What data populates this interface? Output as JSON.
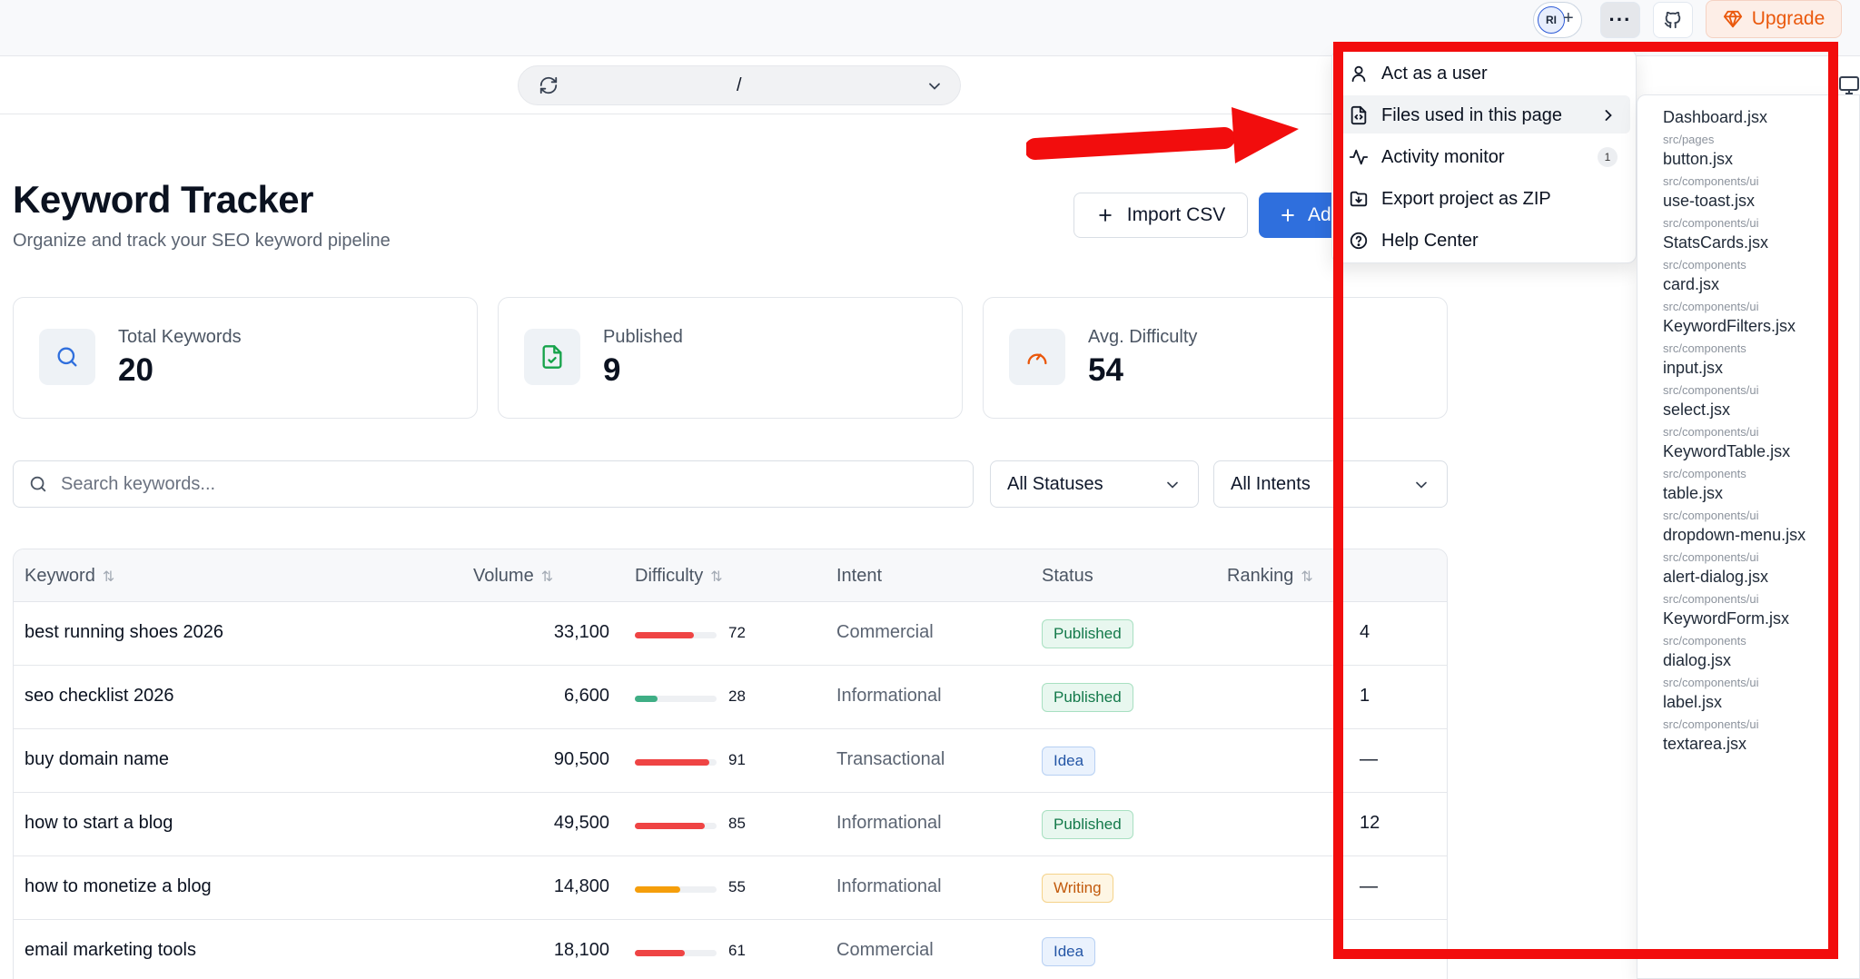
{
  "topbar": {
    "avatar_initials": "RI",
    "avatar_add": "+",
    "more_label": "···",
    "upgrade_label": "Upgrade"
  },
  "urlbar": {
    "path": "/"
  },
  "header": {
    "title": "Keyword Tracker",
    "subtitle": "Organize and track your SEO keyword pipeline",
    "import_label": "Import CSV",
    "add_label": "Ad"
  },
  "stats": [
    {
      "label": "Total Keywords",
      "value": "20",
      "icon": "search-icon"
    },
    {
      "label": "Published",
      "value": "9",
      "icon": "file-check-icon"
    },
    {
      "label": "Avg. Difficulty",
      "value": "54",
      "icon": "gauge-icon"
    }
  ],
  "filters": {
    "search_placeholder": "Search keywords...",
    "status_value": "All Statuses",
    "intent_value": "All Intents"
  },
  "table": {
    "columns": [
      "Keyword",
      "Volume",
      "Difficulty",
      "Intent",
      "Status",
      "Ranking"
    ],
    "rows": [
      {
        "keyword": "best running shoes 2026",
        "volume": "33,100",
        "difficulty": 72,
        "intent": "Commercial",
        "status": "Published",
        "ranking": "4"
      },
      {
        "keyword": "seo checklist 2026",
        "volume": "6,600",
        "difficulty": 28,
        "intent": "Informational",
        "status": "Published",
        "ranking": "1"
      },
      {
        "keyword": "buy domain name",
        "volume": "90,500",
        "difficulty": 91,
        "intent": "Transactional",
        "status": "Idea",
        "ranking": "—"
      },
      {
        "keyword": "how to start a blog",
        "volume": "49,500",
        "difficulty": 85,
        "intent": "Informational",
        "status": "Published",
        "ranking": "12"
      },
      {
        "keyword": "how to monetize a blog",
        "volume": "14,800",
        "difficulty": 55,
        "intent": "Informational",
        "status": "Writing",
        "ranking": "—"
      },
      {
        "keyword": "email marketing tools",
        "volume": "18,100",
        "difficulty": 61,
        "intent": "Commercial",
        "status": "Idea",
        "ranking": "—"
      }
    ]
  },
  "colors": {
    "difficulty_high": "#ef4444",
    "difficulty_medium": "#f59e0b",
    "difficulty_low": "#3fae85",
    "accent": "#2f6fdd",
    "annotation": "#f20d0d"
  },
  "menu": {
    "items": [
      {
        "label": "Act as a user",
        "icon": "user-icon"
      },
      {
        "label": "Files used in this page",
        "icon": "file-code-icon"
      },
      {
        "label": "Activity monitor",
        "icon": "activity-icon",
        "count": "1"
      },
      {
        "label": "Export project as ZIP",
        "icon": "folder-download-icon"
      },
      {
        "label": "Help Center",
        "icon": "help-circle-icon"
      }
    ]
  },
  "files": [
    {
      "name": "Dashboard.jsx",
      "path": "src/pages"
    },
    {
      "name": "button.jsx",
      "path": "src/components/ui"
    },
    {
      "name": "use-toast.jsx",
      "path": "src/components/ui"
    },
    {
      "name": "StatsCards.jsx",
      "path": "src/components"
    },
    {
      "name": "card.jsx",
      "path": "src/components/ui"
    },
    {
      "name": "KeywordFilters.jsx",
      "path": "src/components"
    },
    {
      "name": "input.jsx",
      "path": "src/components/ui"
    },
    {
      "name": "select.jsx",
      "path": "src/components/ui"
    },
    {
      "name": "KeywordTable.jsx",
      "path": "src/components"
    },
    {
      "name": "table.jsx",
      "path": "src/components/ui"
    },
    {
      "name": "dropdown-menu.jsx",
      "path": "src/components/ui"
    },
    {
      "name": "alert-dialog.jsx",
      "path": "src/components/ui"
    },
    {
      "name": "KeywordForm.jsx",
      "path": "src/components"
    },
    {
      "name": "dialog.jsx",
      "path": "src/components/ui"
    },
    {
      "name": "label.jsx",
      "path": "src/components/ui"
    },
    {
      "name": "textarea.jsx",
      "path": ""
    }
  ]
}
